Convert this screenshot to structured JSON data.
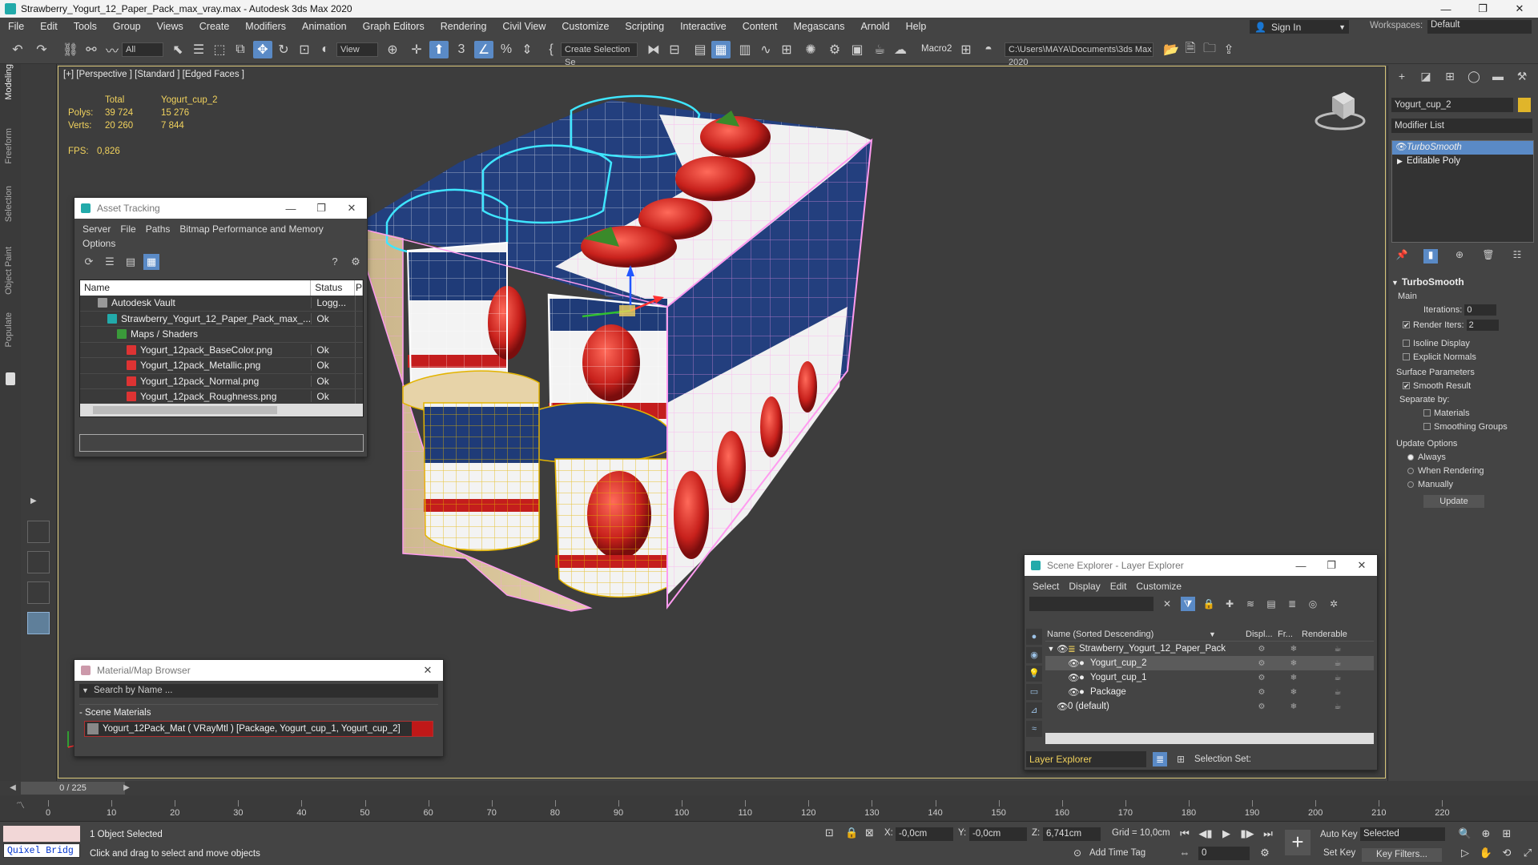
{
  "window": {
    "title": "Strawberry_Yogurt_12_Paper_Pack_max_vray.max - Autodesk 3ds Max 2020",
    "minimize": "—",
    "maximize": "❐",
    "close": "✕"
  },
  "menu": {
    "items": [
      "File",
      "Edit",
      "Tools",
      "Group",
      "Views",
      "Create",
      "Modifiers",
      "Animation",
      "Graph Editors",
      "Rendering",
      "Civil View",
      "Customize",
      "Scripting",
      "Interactive",
      "Content",
      "Megascans",
      "Arnold",
      "Help"
    ],
    "sign_in": "Sign In",
    "workspaces_label": "Workspaces:",
    "workspace_value": "Default"
  },
  "toolbar": {
    "selection_filter": "All",
    "ref_coord": "View",
    "named_selection": "Create Selection Se",
    "macro": "Macro2",
    "project_path": "C:\\Users\\MAYA\\Documents\\3ds Max 2020"
  },
  "ribbon": {
    "tabs": [
      "Modeling",
      "Freeform",
      "Selection",
      "Object Paint",
      "Populate"
    ]
  },
  "viewport": {
    "label": "[+] [Perspective ] [Standard ] [Edged Faces ]",
    "stats": {
      "col_total": "Total",
      "col_object": "Yogurt_cup_2",
      "polys_label": "Polys:",
      "polys_total": "39 724",
      "polys_object": "15 276",
      "verts_label": "Verts:",
      "verts_total": "20 260",
      "verts_object": "7 844",
      "fps_label": "FPS:",
      "fps_value": "0,826"
    }
  },
  "asset_tracking": {
    "title": "Asset Tracking",
    "menu": [
      "Server",
      "File",
      "Paths",
      "Bitmap Performance and Memory",
      "Options"
    ],
    "columns": [
      "Name",
      "Status",
      "P"
    ],
    "rows": [
      {
        "name": "Autodesk Vault",
        "status": "Logg...",
        "icon": "vault-icon"
      },
      {
        "name": "Strawberry_Yogurt_12_Paper_Pack_max_...",
        "status": "Ok",
        "icon": "max-file-icon"
      },
      {
        "name": "Maps / Shaders",
        "status": "",
        "icon": "maps-icon"
      },
      {
        "name": "Yogurt_12pack_BaseColor.png",
        "status": "Ok",
        "icon": "image-file-icon"
      },
      {
        "name": "Yogurt_12pack_Metallic.png",
        "status": "Ok",
        "icon": "image-file-icon"
      },
      {
        "name": "Yogurt_12pack_Normal.png",
        "status": "Ok",
        "icon": "image-file-icon"
      },
      {
        "name": "Yogurt_12pack_Roughness.png",
        "status": "Ok",
        "icon": "image-file-icon"
      }
    ]
  },
  "material_browser": {
    "title": "Material/Map Browser",
    "search_placeholder": "Search by Name ...",
    "group": "- Scene Materials",
    "material": "Yogurt_12Pack_Mat  ( VRayMtl ) [Package, Yogurt_cup_1, Yogurt_cup_2]",
    "material_color": "#c01818"
  },
  "scene_explorer": {
    "title": "Scene Explorer - Layer Explorer",
    "menu": [
      "Select",
      "Display",
      "Edit",
      "Customize"
    ],
    "columns": {
      "name": "Name (Sorted Descending)",
      "display": "Displ...",
      "freeze": "Fr...",
      "renderable": "Renderable"
    },
    "rows": [
      {
        "name": "Strawberry_Yogurt_12_Paper_Pack",
        "level": 0,
        "selected": false
      },
      {
        "name": "Yogurt_cup_2",
        "level": 1,
        "selected": true
      },
      {
        "name": "Yogurt_cup_1",
        "level": 1,
        "selected": false
      },
      {
        "name": "Package",
        "level": 1,
        "selected": false
      },
      {
        "name": "0 (default)",
        "level": 0,
        "selected": false
      }
    ],
    "layer_explorer": "Layer Explorer",
    "selection_set_label": "Selection Set:"
  },
  "command_panel": {
    "object_name": "Yogurt_cup_2",
    "object_color": "#e0b52a",
    "modifier_list": "Modifier List",
    "stack": [
      "TurboSmooth",
      "Editable Poly"
    ],
    "turbosmooth": {
      "title": "TurboSmooth",
      "main": "Main",
      "iterations_label": "Iterations:",
      "iterations": "0",
      "render_iters_label": "Render Iters:",
      "render_iters": "2",
      "isoline": "Isoline Display",
      "explicit_normals": "Explicit Normals",
      "surface_params": "Surface Parameters",
      "smooth_result": "Smooth Result",
      "separate_by": "Separate by:",
      "materials": "Materials",
      "smoothing_groups": "Smoothing Groups",
      "update_options": "Update Options",
      "always": "Always",
      "when_rendering": "When Rendering",
      "manually": "Manually",
      "update": "Update"
    }
  },
  "timeline": {
    "frame": "0 / 225",
    "ticks": [
      "0",
      "10",
      "20",
      "30",
      "40",
      "50",
      "60",
      "70",
      "80",
      "90",
      "100",
      "110",
      "120",
      "130",
      "140",
      "150",
      "160",
      "170",
      "180",
      "190",
      "200",
      "210",
      "220"
    ]
  },
  "statusbar": {
    "selection": "1 Object Selected",
    "prompt": "Click and drag to select and move objects",
    "quixel": "Quixel Bridg",
    "x_label": "X:",
    "x_value": "-0,0cm",
    "y_label": "Y:",
    "y_value": "-0,0cm",
    "z_label": "Z:",
    "z_value": "6,741cm",
    "grid": "Grid = 10,0cm",
    "add_time_tag": "Add Time Tag",
    "auto_key": "Auto Key",
    "set_key": "Set Key",
    "key_mode": "Selected",
    "key_filters": "Key Filters...",
    "current_frame": "0"
  }
}
